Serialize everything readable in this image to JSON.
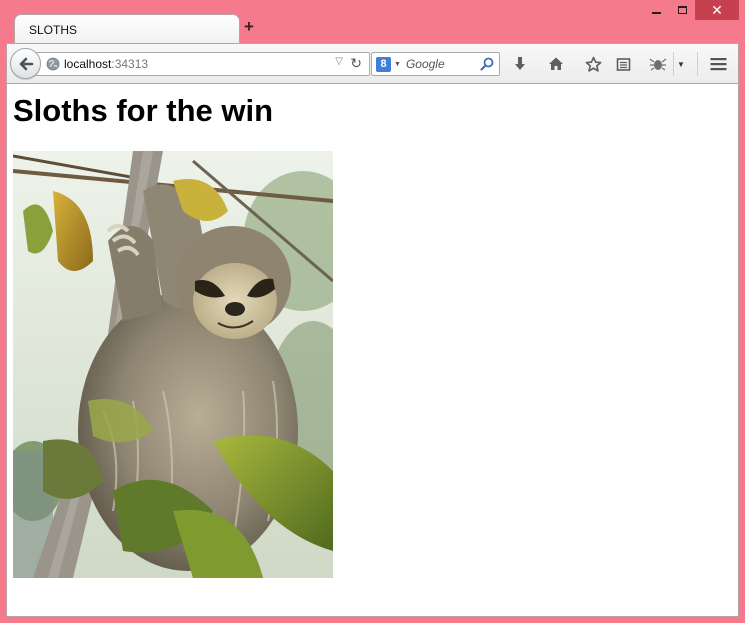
{
  "window": {
    "minimize_icon": "minimize-icon",
    "maximize_icon": "maximize-icon",
    "close_icon": "close-icon"
  },
  "tabs": [
    {
      "label": "SLOTHS",
      "active": true
    }
  ],
  "toolbar": {
    "url_host": "localhost",
    "url_port": ":34313",
    "search_engine_letter": "8",
    "search_placeholder": "Google"
  },
  "page": {
    "heading": "Sloths for the win",
    "image_alt": "sloth"
  },
  "colors": {
    "window_frame": "#f47a8c",
    "close_button": "#c7404f",
    "search_engine_blue": "#3f7fd8"
  }
}
